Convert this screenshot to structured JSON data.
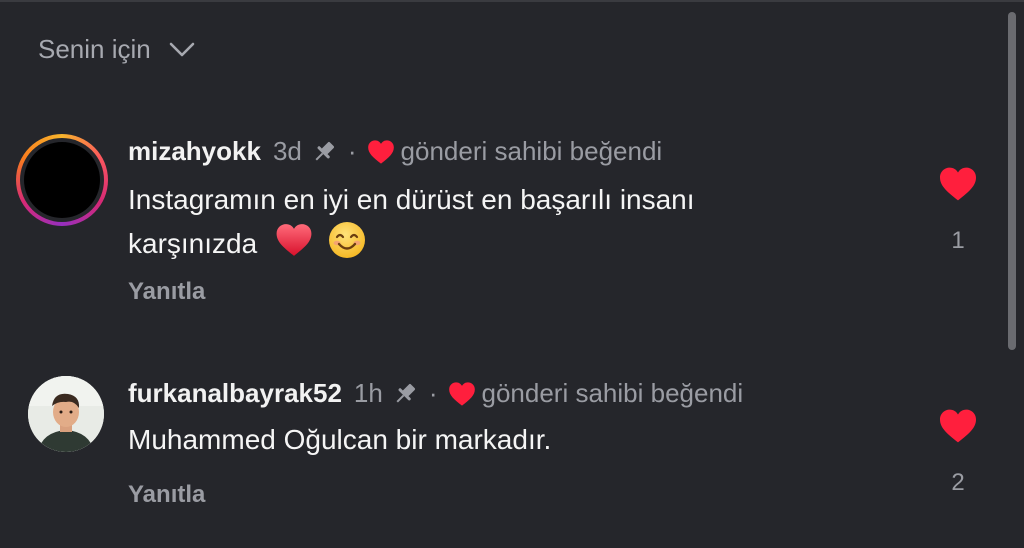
{
  "header": {
    "filter_label": "Senin için"
  },
  "comments": [
    {
      "username": "mizahyokk",
      "time": "3d",
      "liked_by_author": "gönderi sahibi beğendi",
      "text_line1": "Instagramın en iyi en dürüst en başarılı insanı",
      "text_line2": "karşınızda",
      "emojis": [
        "red-heart-emoji",
        "smiling-face-emoji"
      ],
      "reply_label": "Yanıtla",
      "like_count": "1",
      "avatar": "avatar-with-story-ring"
    },
    {
      "username": "furkanalbayrak52",
      "time": "1h",
      "liked_by_author": "gönderi sahibi beğendi",
      "text_line1": "Muhammed Oğulcan bir markadır.",
      "reply_label": "Yanıtla",
      "like_count": "2",
      "avatar": "profile-photo"
    }
  ],
  "icons": {
    "chevron": "chevron-down-icon",
    "pin": "pin-icon",
    "heart": "heart-icon"
  },
  "colors": {
    "background": "#25262b",
    "heart": "#ff1f3d",
    "muted_text": "#9a9ca3"
  }
}
